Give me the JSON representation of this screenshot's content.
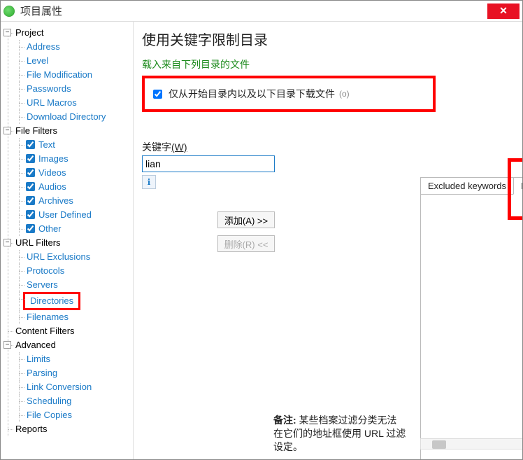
{
  "window": {
    "title": "项目属性",
    "close_glyph": "✕"
  },
  "tree": {
    "project": {
      "label": "Project",
      "children": [
        {
          "label": "Address"
        },
        {
          "label": "Level"
        },
        {
          "label": "File Modification"
        },
        {
          "label": "Passwords"
        },
        {
          "label": "URL Macros"
        },
        {
          "label": "Download Directory"
        }
      ]
    },
    "file_filters": {
      "label": "File Filters",
      "children": [
        {
          "label": "Text"
        },
        {
          "label": "Images"
        },
        {
          "label": "Videos"
        },
        {
          "label": "Audios"
        },
        {
          "label": "Archives"
        },
        {
          "label": "User Defined"
        },
        {
          "label": "Other"
        }
      ]
    },
    "url_filters": {
      "label": "URL Filters",
      "children": [
        {
          "label": "URL Exclusions"
        },
        {
          "label": "Protocols"
        },
        {
          "label": "Servers"
        },
        {
          "label": "Directories"
        },
        {
          "label": "Filenames"
        }
      ]
    },
    "content_filters": {
      "label": "Content Filters"
    },
    "advanced": {
      "label": "Advanced",
      "children": [
        {
          "label": "Limits"
        },
        {
          "label": "Parsing"
        },
        {
          "label": "Link Conversion"
        },
        {
          "label": "Scheduling"
        },
        {
          "label": "File Copies"
        }
      ]
    },
    "reports": {
      "label": "Reports"
    }
  },
  "main": {
    "title": "使用关键字限制目录",
    "subtitle": "载入来自下列目录的文件",
    "only_checkbox_label": "仅从开始目录内以及以下目录下载文件",
    "only_checkbox_key": "(o)",
    "kw_label_pre": "关键字",
    "kw_label_key": "(W)",
    "kw_input_value": "lian",
    "add_btn": "添加(A)  >>",
    "del_btn": "删除(R)  <<",
    "tab_excluded": "Excluded keywords",
    "tab_included": "Included keywords",
    "footnote_label": "备注:",
    "footnote_text": "某些档案过滤分类无法在它们的地址框使用 URL 过滤设定。"
  }
}
